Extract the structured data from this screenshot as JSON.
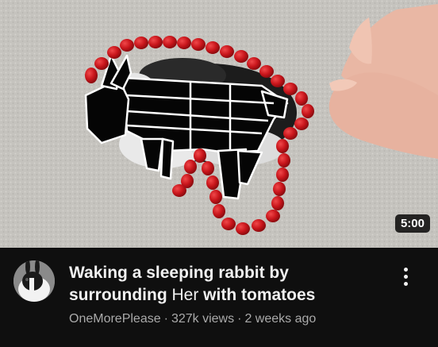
{
  "video": {
    "duration": "5:00",
    "title_line1": "Waking a sleeping rabbit by",
    "title_line2_before": "surrounding ",
    "title_line2_overlay": "Her",
    "title_line2_after": " with tomatoes",
    "channel": "OneMorePlease",
    "views": "327k views",
    "age": "2 weeks ago",
    "separator": "·"
  },
  "icons": {
    "menu": "more-vert-icon",
    "avatar": "channel-avatar-rabbit"
  },
  "colors": {
    "background": "#0f0f0f",
    "title": "#f1f1f1",
    "subtext": "#aaaaaa",
    "tomato": "#d11a1f",
    "carpet": "#c6c4bf"
  }
}
